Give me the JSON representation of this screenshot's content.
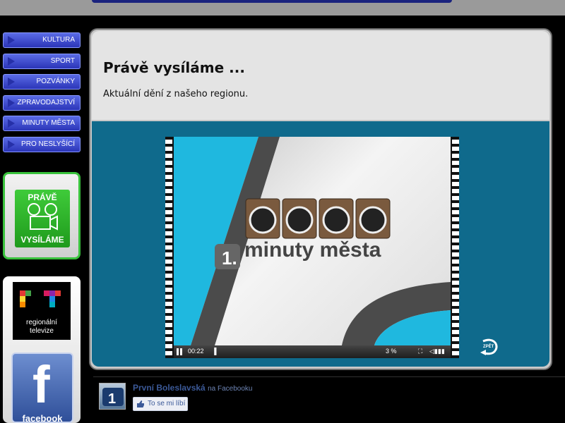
{
  "nav": {
    "items": [
      {
        "label": "KULTURA"
      },
      {
        "label": "SPORT"
      },
      {
        "label": "POZVÁNKY"
      },
      {
        "label": "ZPRAVODAJSTVÍ"
      },
      {
        "label": "MINUTY MĚSTA"
      },
      {
        "label": "PRO NESLYŠÍCÍ"
      }
    ]
  },
  "promo": {
    "line1": "PRÁVĚ",
    "line2": "VYSÍLÁME",
    "icon": "film-camera-icon"
  },
  "rtv": {
    "line1": "regionální",
    "line2": "televize"
  },
  "fb_logo": {
    "letter": "f",
    "word": "facebook"
  },
  "main": {
    "title": "Právě vysíláme ...",
    "subtitle": "Aktuální dění z našeho regionu."
  },
  "player": {
    "brand_text": "minuty města",
    "time": "00:22",
    "percent": "3 %",
    "back_label": "ZPĚT"
  },
  "fb_box": {
    "page_name": "První Boleslavská",
    "page_suffix": "na Facebooku",
    "like_label": "To se mi líbí"
  },
  "colors": {
    "nav_blue": "#2b35b8",
    "accent_green": "#39c23c",
    "teal": "#0f6a8c",
    "fb_blue": "#3b5998"
  }
}
